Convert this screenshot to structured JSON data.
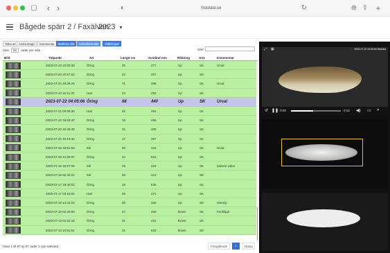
{
  "browser": {
    "url": "fiskdata.se",
    "back": "‹",
    "forward": "›",
    "sidebar": "▢",
    "shield": "◐",
    "reload": "↻",
    "download": "⊕",
    "share": "⇪",
    "newtab": "+"
  },
  "header": {
    "title": "Bågede spärr 2 / Faxälven",
    "year": "2023",
    "year_caret": "▾"
  },
  "toolbar": {
    "buttons": [
      "Tolka art",
      "Ändra längd",
      "Kommentar",
      "Markera alla",
      "Avmarkera alla",
      "Vidbilringar"
    ]
  },
  "table_controls": {
    "show_label": "Visa",
    "page_size": "50",
    "per_page_label": "rader per sida",
    "search_label": "Sök:"
  },
  "table": {
    "headers": [
      "Bild",
      "Tidpunkt",
      "Art",
      "Längd cm",
      "Avstånd mm",
      "Riktning",
      "Anv.",
      "Kommentar"
    ],
    "rows": [
      {
        "time": "2023-07-23 22:00:38",
        "species": "Öring",
        "length": "25",
        "distance": "377",
        "direction": "Up",
        "anv": "SK",
        "comment": "Urval"
      },
      {
        "time": "2023-07-23 20:57:52",
        "species": "Öring",
        "length": "23",
        "distance": "407",
        "direction": "Up",
        "anv": "SK",
        "comment": ""
      },
      {
        "time": "2023-07-23 16:36:29",
        "species": "Öring",
        "length": "71",
        "distance": "398",
        "direction": "Up",
        "anv": "SK",
        "comment": "Urval"
      },
      {
        "time": "2023-07-23 16:11:20",
        "species": "Harr",
        "length": "23",
        "distance": "493",
        "direction": "Up",
        "anv": "SK",
        "comment": ""
      },
      {
        "time": "2023-07-22 04:05:06",
        "species": "Öring",
        "length": "68",
        "distance": "440",
        "direction": "Up",
        "anv": "SK",
        "comment": "Urval",
        "selected": true
      },
      {
        "time": "2023-07-21 00:08:35",
        "species": "Harr",
        "length": "45",
        "distance": "454",
        "direction": "Up",
        "anv": "SK",
        "comment": ""
      },
      {
        "time": "2023-07-20 19:02:47",
        "species": "Öring",
        "length": "19",
        "distance": "496",
        "direction": "Up",
        "anv": "SK",
        "comment": ""
      },
      {
        "time": "2023-07-20 16:49:46",
        "species": "Öring",
        "length": "32",
        "distance": "408",
        "direction": "Up",
        "anv": "SK",
        "comment": ""
      },
      {
        "time": "2023-07-20 15:19:45",
        "species": "Öring",
        "length": "17",
        "distance": "397",
        "direction": "Up",
        "anv": "SK",
        "comment": ""
      },
      {
        "time": "2023-07-19 18:51:52",
        "species": "Sik",
        "length": "30",
        "distance": "443",
        "direction": "Up",
        "anv": "SK",
        "comment": "Urval"
      },
      {
        "time": "2023-07-18 21:09:07",
        "species": "Öring",
        "length": "14",
        "distance": "531",
        "direction": "Up",
        "anv": "SK",
        "comment": ""
      },
      {
        "time": "2023-07-18 20:07:06",
        "species": "Sik",
        "length": "25",
        "distance": "419",
        "direction": "Up",
        "anv": "SK",
        "comment": "Saknar video"
      },
      {
        "time": "2023-07-18 02:40:24",
        "species": "Sik",
        "length": "30",
        "distance": "421",
        "direction": "Up",
        "anv": "SK",
        "comment": ""
      },
      {
        "time": "2023-07-17 18:40:04",
        "species": "Öring",
        "length": "18",
        "distance": "535",
        "direction": "Up",
        "anv": "SK",
        "comment": ""
      },
      {
        "time": "2023-07-17 03:15:52",
        "species": "Harr",
        "length": "35",
        "distance": "471",
        "direction": "Up",
        "anv": "SK",
        "comment": ""
      },
      {
        "time": "2023-07-15 14:42:22",
        "species": "Öring",
        "length": "60",
        "distance": "458",
        "direction": "Up",
        "anv": "SK",
        "comment": "Sisenip"
      },
      {
        "time": "2023-07-15 02:45:55",
        "species": "Öring",
        "length": "27",
        "distance": "458",
        "direction": "Down",
        "anv": "SK",
        "comment": "Fenklippt"
      },
      {
        "time": "2023-07-13 01:02:18",
        "species": "Öring",
        "length": "31",
        "distance": "431",
        "direction": "Down",
        "anv": "SK",
        "comment": ""
      },
      {
        "time": "2023-07-13 10:51:51",
        "species": "Öring",
        "length": "31",
        "distance": "533",
        "direction": "Down",
        "anv": "SK",
        "comment": ""
      }
    ]
  },
  "footer": {
    "info": "Visar 1 till 87 av 87 rader  1 row selected",
    "prev": "Föregående",
    "page": "1",
    "next": "Nästa"
  },
  "video": {
    "timestamp": "2023-07-22 04:05:06 fiskdata",
    "current_time": "0:00",
    "duration": "0:12",
    "progress": 0.45
  }
}
